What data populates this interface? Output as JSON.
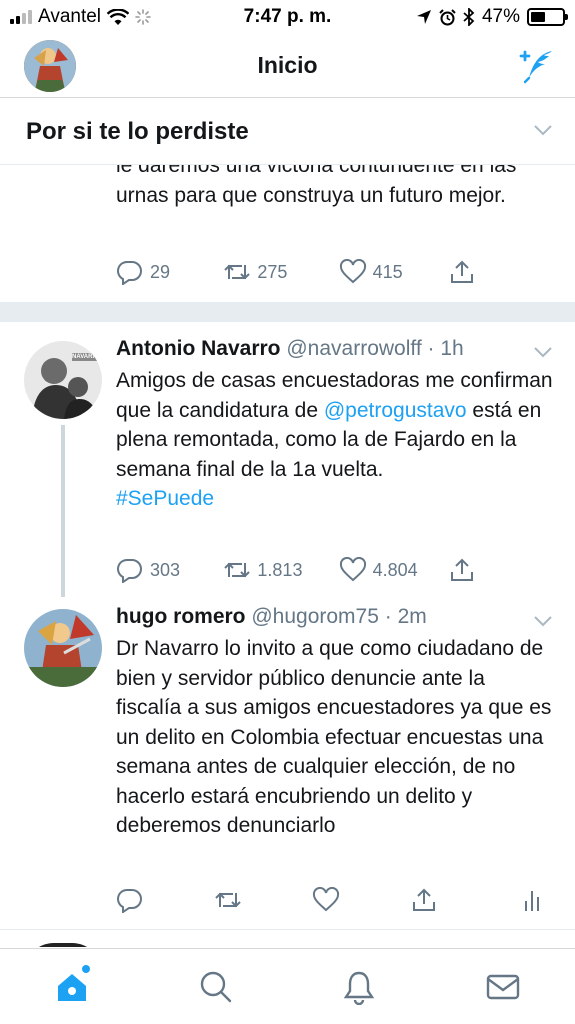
{
  "status_bar": {
    "carrier": "Avantel",
    "time": "7:47 p. m.",
    "battery": "47%",
    "battery_level": 0.47
  },
  "header": {
    "title": "Inicio"
  },
  "section": {
    "title": "Por si te lo perdiste"
  },
  "partial_tweet": {
    "text": "le daremos una victoria contundente en las urnas para que construya un futuro mejor.",
    "replies": "29",
    "retweets": "275",
    "likes": "415"
  },
  "tweets": [
    {
      "name": "Antonio Navarro",
      "handle": "@navarrowolff",
      "time": "· 1h",
      "avatar_label": "NAVARRO",
      "text_before": "Amigos de casas encuestadoras me confirman que la candidatura de ",
      "mention": "@petrogustavo",
      "text_after": " está en plena remontada, como la de Fajardo en la semana final de la 1a vuelta.",
      "hashtag": "#SePuede",
      "replies": "303",
      "retweets": "1.813",
      "likes": "4.804"
    },
    {
      "name": "hugo romero",
      "handle": "@hugorom75",
      "time": "· 2m",
      "text": "Dr Navarro lo invito a que como ciudadano de bien y servidor público denuncie ante la fiscalía a sus amigos encuestadores ya que es un delito en Colombia efectuar encuestas una semana antes de cualquier elección, de no hacerlo estará encubriendo un delito y deberemos denunciarlo"
    }
  ],
  "colors": {
    "brand": "#1da1f2",
    "text": "#14171a",
    "muted": "#657786",
    "separator": "#e6ecf0"
  },
  "tabs": [
    {
      "name": "home-icon"
    },
    {
      "name": "search-icon"
    },
    {
      "name": "bell-icon"
    },
    {
      "name": "mail-icon"
    }
  ]
}
